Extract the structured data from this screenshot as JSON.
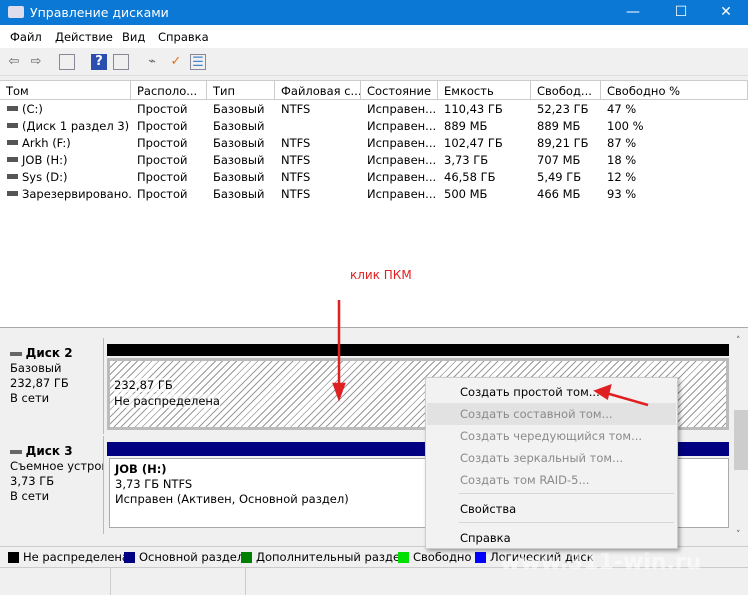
{
  "window": {
    "title": "Управление дисками",
    "minimize": "—",
    "maximize": "☐",
    "close": "✕"
  },
  "menu": [
    "Файл",
    "Действие",
    "Вид",
    "Справка"
  ],
  "toolbar": [
    "back-icon",
    "forward-icon",
    "console-tree-icon",
    "help-icon",
    "action-pane-icon",
    "connect-icon",
    "check-icon",
    "properties-icon"
  ],
  "table": {
    "columns": [
      "Том",
      "Располо...",
      "Тип",
      "Файловая с...",
      "Состояние",
      "Емкость",
      "Свобод...",
      "Свободно %"
    ],
    "rows": [
      [
        "(C:)",
        "Простой",
        "Базовый",
        "NTFS",
        "Исправен...",
        "110,43 ГБ",
        "52,23 ГБ",
        "47 %"
      ],
      [
        "(Диск 1 раздел 3)",
        "Простой",
        "Базовый",
        "",
        "Исправен...",
        "889 МБ",
        "889 МБ",
        "100 %"
      ],
      [
        "Arkh (F:)",
        "Простой",
        "Базовый",
        "NTFS",
        "Исправен...",
        "102,47 ГБ",
        "89,21 ГБ",
        "87 %"
      ],
      [
        "JOB (H:)",
        "Простой",
        "Базовый",
        "NTFS",
        "Исправен...",
        "3,73 ГБ",
        "707 МБ",
        "18 %"
      ],
      [
        "Sys (D:)",
        "Простой",
        "Базовый",
        "NTFS",
        "Исправен...",
        "46,58 ГБ",
        "5,49 ГБ",
        "12 %"
      ],
      [
        "Зарезервировано...",
        "Простой",
        "Базовый",
        "NTFS",
        "Исправен...",
        "500 МБ",
        "466 МБ",
        "93 %"
      ]
    ]
  },
  "annotation": {
    "text": "клик ПКМ",
    "color": "#e02020"
  },
  "disks": [
    {
      "name": "Диск 2",
      "type": "Базовый",
      "size": "232,87 ГБ",
      "status": "В сети",
      "partition": {
        "size": "232,87 ГБ",
        "label": "Не распределена"
      },
      "bar_color": "#000000"
    },
    {
      "name": "Диск 3",
      "type": "Съемное устройство",
      "size": "3,73 ГБ",
      "status": "В сети",
      "partition": {
        "name": "JOB  (H:)",
        "size": "3,73 ГБ NTFS",
        "label": "Исправен (Активен, Основной раздел)"
      },
      "bar_color": "#000080"
    }
  ],
  "context_menu": [
    {
      "label": "Создать простой том...",
      "enabled": true
    },
    {
      "label": "Создать составной том...",
      "enabled": false
    },
    {
      "label": "Создать чередующийся том...",
      "enabled": false
    },
    {
      "label": "Создать зеркальный том...",
      "enabled": false
    },
    {
      "label": "Создать том RAID-5...",
      "enabled": false
    },
    {
      "label": "Свойства",
      "enabled": true
    },
    {
      "label": "Справка",
      "enabled": true
    }
  ],
  "legend": [
    {
      "label": "Не распределена",
      "color": "#000000"
    },
    {
      "label": "Основной раздел",
      "color": "#000080"
    },
    {
      "label": "Дополнительный раздел",
      "color": "#008000"
    },
    {
      "label": "Свободно",
      "color": "#00e000"
    },
    {
      "label": "Логический диск",
      "color": "#0000ff"
    }
  ],
  "watermark": "www.311-win.ru"
}
